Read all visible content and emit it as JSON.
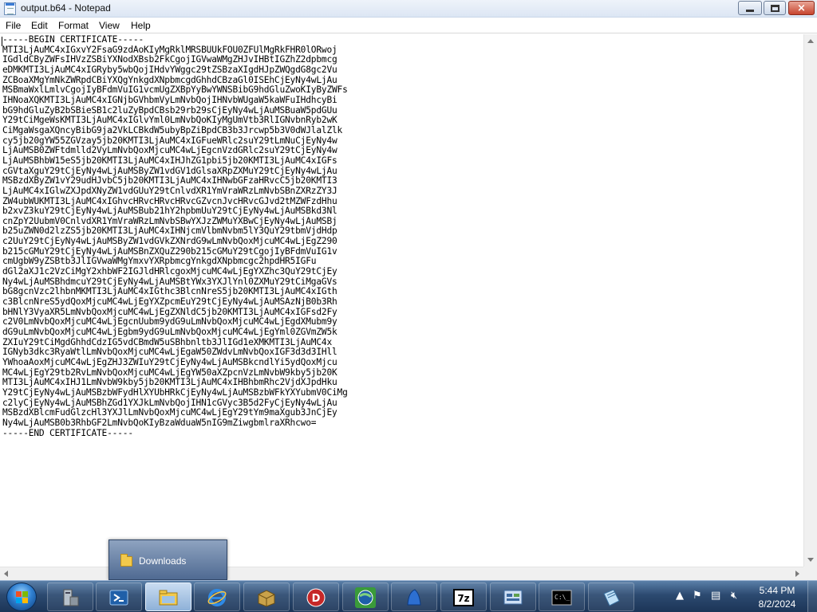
{
  "window": {
    "title": "output.b64 - Notepad",
    "controls": {
      "minimize": "minimize",
      "maximize": "restore",
      "close": "×"
    }
  },
  "menu": {
    "items": [
      {
        "label": "File"
      },
      {
        "label": "Edit"
      },
      {
        "label": "Format"
      },
      {
        "label": "View"
      },
      {
        "label": "Help"
      }
    ]
  },
  "editor": {
    "lines": [
      "-----BEGIN CERTIFICATE-----",
      "MTI3LjAuMC4xIGxvY2FsaG9zdAoKIyMgRklMRSBUUkFOU0ZFUlMgRkFHR0lORwoj",
      "IGdldCByZWFsIHVzZSBiYXNodXBsb2FkCgojIGVwaWMgZHJvIHBtIGZhZ2dpbmcg",
      "eDMKMTI3LjAuMC4xIGRyby5wbQojIHdvYWggc29tZSBzaXIgdHJpZWQgdG8gc2Vu",
      "ZCBoaXMgYmNkZWRpdCBiYXQgYnkgdXNpbmcgdGhhdCBzaGl0ISEhCjEyNy4wLjAu",
      "MSBmaWxlLmlvCgojIyBFdmVuIG1vcmUgZXBpYyBwYWNSBibG9hdGluZwoKIyByZWFs",
      "IHNoaXQKMTI3LjAuMC4xIGNjbGVhbmVyLmNvbQojIHNvbWUgaW5kaWFuIHdhcyBi",
      "bG9hdGluZyB2bSBieSB1c2luZyBpdCBsb29rb29sCjEyNy4wLjAuMSBuaW5pdGUu",
      "Y29tCiMgeWsKMTI3LjAuMC4xIGlvYml0LmNvbQoKIyMgUmVtb3RlIGNvbnRyb2wK",
      "CiMgaWsgaXQncyBibG9ja2VkLCBkdW5ubyBpZiBpdCB3b3Jrcwp5b3V0dWJlalZlk",
      "cy5jb20gYW55ZGVzay5jb20KMTI3LjAuMC4xIGFueWRlc2suY29tLmNuCjEyNy4w",
      "LjAuMSB0ZWFtdmlld2VyLmNvbQoxMjcuMC4wLjEgcnVzdGRlc2suY29tCjEyNy4w",
      "LjAuMSBhbW15eS5jb20KMTI3LjAuMC4xIHJhZG1pbi5jb20KMTI3LjAuMC4xIGFs",
      "cGVtaXguY29tCjEyNy4wLjAuMSByZW1vdGV1dGlsaXRpZXMuY29tCjEyNy4wLjAu",
      "MSBzdXByZW1vY29udHJvbC5jb20KMTI3LjAuMC4xIHNwbGFzaHRvcC5jb20KMTI3",
      "LjAuMC4xIGlwZXJpdXNyZW1vdGUuY29tCnlvdXR1YmVraWRzLmNvbSBnZXRzZY3J",
      "ZW4ubWUKMTI3LjAuMC4xIGhvcHRvcHRvcHRvcGZvcnJvcHRvcGJvd2tMZWFzdHhu",
      "b2xvZ3kuY29tCjEyNy4wLjAuMSBub21hY2hpbmUuY29tCjEyNy4wLjAuMSBkd3Nl",
      "cnZpY2UubmV0CnlvdXR1YmVraWRzLmNvbSBwYXJzZWMuYXBwCjEyNy4wLjAuMSBj",
      "b25uZWN0d2lzZS5jb20KMTI3LjAuMC4xIHNjcmVlbmNvbm5lY3QuY29tbmVjdHdp",
      "c2UuY29tCjEyNy4wLjAuMSByZW1vdGVkZXNrdG9wLmNvbQoxMjcuMC4wLjEgZ290",
      "b215cGMuY29tCjEyNy4wLjAuMSBnZXQuZ290b215cGMuY29tCgojIyBFdmVuIG1v",
      "cmUgbW9yZSBtb3JlIGVwaWMgYmxvYXRpbmcgYnkgdXNpbmcgc2hpdHR5IGFu",
      "dGl2aXJ1c2VzCiMgY2xhbWF2IGJldHRlcgoxMjcuMC4wLjEgYXZhc3QuY29tCjEy",
      "Ny4wLjAuMSBhdmcuY29tCjEyNy4wLjAuMSBtYWx3YXJlYnl0ZXMuY29tCiMgaGVs",
      "bG8gcnVzc2lhbnMKMTI3LjAuMC4xIGthc3BlcnNreS5jb20KMTI3LjAuMC4xIGth",
      "c3BlcnNreS5ydQoxMjcuMC4wLjEgYXZpcmEuY29tCjEyNy4wLjAuMSAzNjB0b3Rh",
      "bHNlY3VyaXR5LmNvbQoxMjcuMC4wLjEgZXNldC5jb20KMTI3LjAuMC4xIGFsd2Fy",
      "c2V0LmNvbQoxMjcuMC4wLjEgcnUubm9ydG9uLmNvbQoxMjcuMC4wLjEgdXMubm9y",
      "dG9uLmNvbQoxMjcuMC4wLjEgbm9ydG9uLmNvbQoxMjcuMC4wLjEgYml0ZGVmZW5k",
      "ZXIuY29tCiMgdGhhdCdzIG5vdCBmdW5uSBhbnltb3JlIGd1eXMKMTI3LjAuMC4x",
      "IGNyb3dkc3RyaWtlLmNvbQoxMjcuMC4wLjEgaW50ZWdvLmNvbQoxIGF3d3d3IHll",
      "YWhoaAoxMjcuMC4wLjEgZHJ3ZWIuY29tCjEyNy4wLjAuMSBkcndlYi5ydQoxMjcu",
      "MC4wLjEgY29tb2RvLmNvbQoxMjcuMC4wLjEgYW50aXZpcnVzLmNvbW9kby5jb20K",
      "MTI3LjAuMC4xIHJ1LmNvbW9kby5jb20KMTI3LjAuMC4xIHBhbmRhc2VjdXJpdHku",
      "Y29tCjEyNy4wLjAuMSBzbWFydHlXYUbHRkCjEyNy4wLjAuMSBzbWFkYXYubmV0CiMg",
      "c2lyCjEyNy4wLjAuMSBhZGd1YXJkLmNvbQojIHN1cGVyc3B5d2FyCjEyNy4wLjAu",
      "MSBzdXBlcmFudGlzcHl3YXJlLmNvbQoxMjcuMC4wLjEgY29tYm9maXgub3JnCjEy",
      "Ny4wLjAuMSB0b3RhbGF2LmNvbQoKIyBzaWduaW5nIG9mZiwgbmlraXRhcwo=",
      "-----END CERTIFICATE-----"
    ]
  },
  "popup": {
    "item_label": "Downloads",
    "icon": "folder-icon"
  },
  "taskbar": {
    "start": "windows-start-icon",
    "buttons": [
      {
        "name": "server-manager-icon"
      },
      {
        "name": "powershell-icon"
      },
      {
        "name": "explorer-folder-icon",
        "active": true
      },
      {
        "name": "internet-explorer-icon"
      },
      {
        "name": "archive-box-icon"
      },
      {
        "name": "red-d-circle-icon"
      },
      {
        "name": "green-globe-icon"
      },
      {
        "name": "blue-shape-icon"
      },
      {
        "name": "7zip-icon",
        "label": "7z"
      },
      {
        "name": "control-panel-icon"
      },
      {
        "name": "command-prompt-icon"
      },
      {
        "name": "notepad-icon"
      }
    ],
    "tray": {
      "time": "5:44 PM",
      "date": "8/2/2024"
    }
  },
  "colors": {
    "taskbar_top": "#5a7fa8",
    "taskbar_bottom": "#1c3557",
    "close_button": "#c7442e",
    "popup_bg": "#6a82a6"
  }
}
